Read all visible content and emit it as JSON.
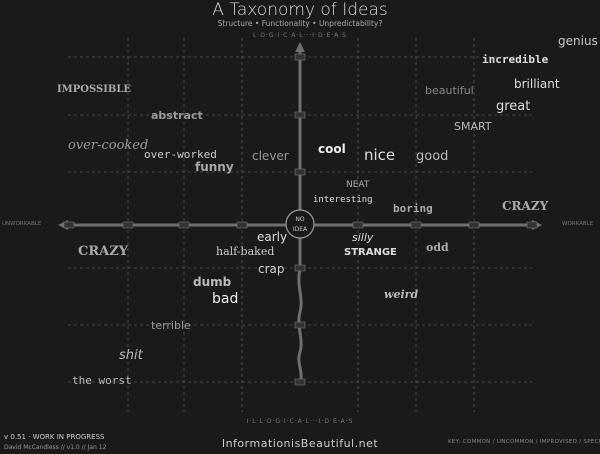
{
  "title": "A Taxonomy of Ideas",
  "subtitle": "Structure • Functionality • Unpredictability?",
  "axis_labels": {
    "top": "L·O·G·I·C·A·L···I·D·E·A·S",
    "bottom": "I·L·L·O·G·I·C·A·L···I·D·E·A·S",
    "left": "UNWORKABLE",
    "right": "WORKABLE"
  },
  "footer": {
    "version": "v 0.51 · WORK IN PROGRESS",
    "credit": "David McCandless // v1.0 // Jan 12",
    "site": "InformationisBeautiful.net",
    "key": "KEY: COMMON / UNCOMMON / IMPROVISED / SPECIALIST"
  },
  "colors": {
    "background": "#1a1a1a",
    "axis": "#6f6f6f",
    "grid": "#555555",
    "text_bright": "#e6e6e6",
    "text_mid": "#b4b4b4",
    "text_dim": "#8a8a8a"
  },
  "center_badge": [
    "NO",
    "IDEA"
  ],
  "words": [
    {
      "text": "genius"
    },
    {
      "text": "incredible"
    },
    {
      "text": "brilliant"
    },
    {
      "text": "beautiful"
    },
    {
      "text": "great"
    },
    {
      "text": "SMART"
    },
    {
      "text": "IMPOSSIBLE"
    },
    {
      "text": "abstract"
    },
    {
      "text": "over-cooked"
    },
    {
      "text": "over-worked"
    },
    {
      "text": "funny"
    },
    {
      "text": "clever"
    },
    {
      "text": "cool"
    },
    {
      "text": "nice"
    },
    {
      "text": "good"
    },
    {
      "text": "NEAT"
    },
    {
      "text": "interesting"
    },
    {
      "text": "boring"
    },
    {
      "text": "CRAZY"
    },
    {
      "text": "early"
    },
    {
      "text": "silly"
    },
    {
      "text": "half-baked"
    },
    {
      "text": "STRANGE"
    },
    {
      "text": "odd"
    },
    {
      "text": "CRAZY"
    },
    {
      "text": "crap"
    },
    {
      "text": "dumb"
    },
    {
      "text": "bad"
    },
    {
      "text": "weird"
    },
    {
      "text": "terrible"
    },
    {
      "text": "shit"
    },
    {
      "text": "the worst"
    }
  ]
}
